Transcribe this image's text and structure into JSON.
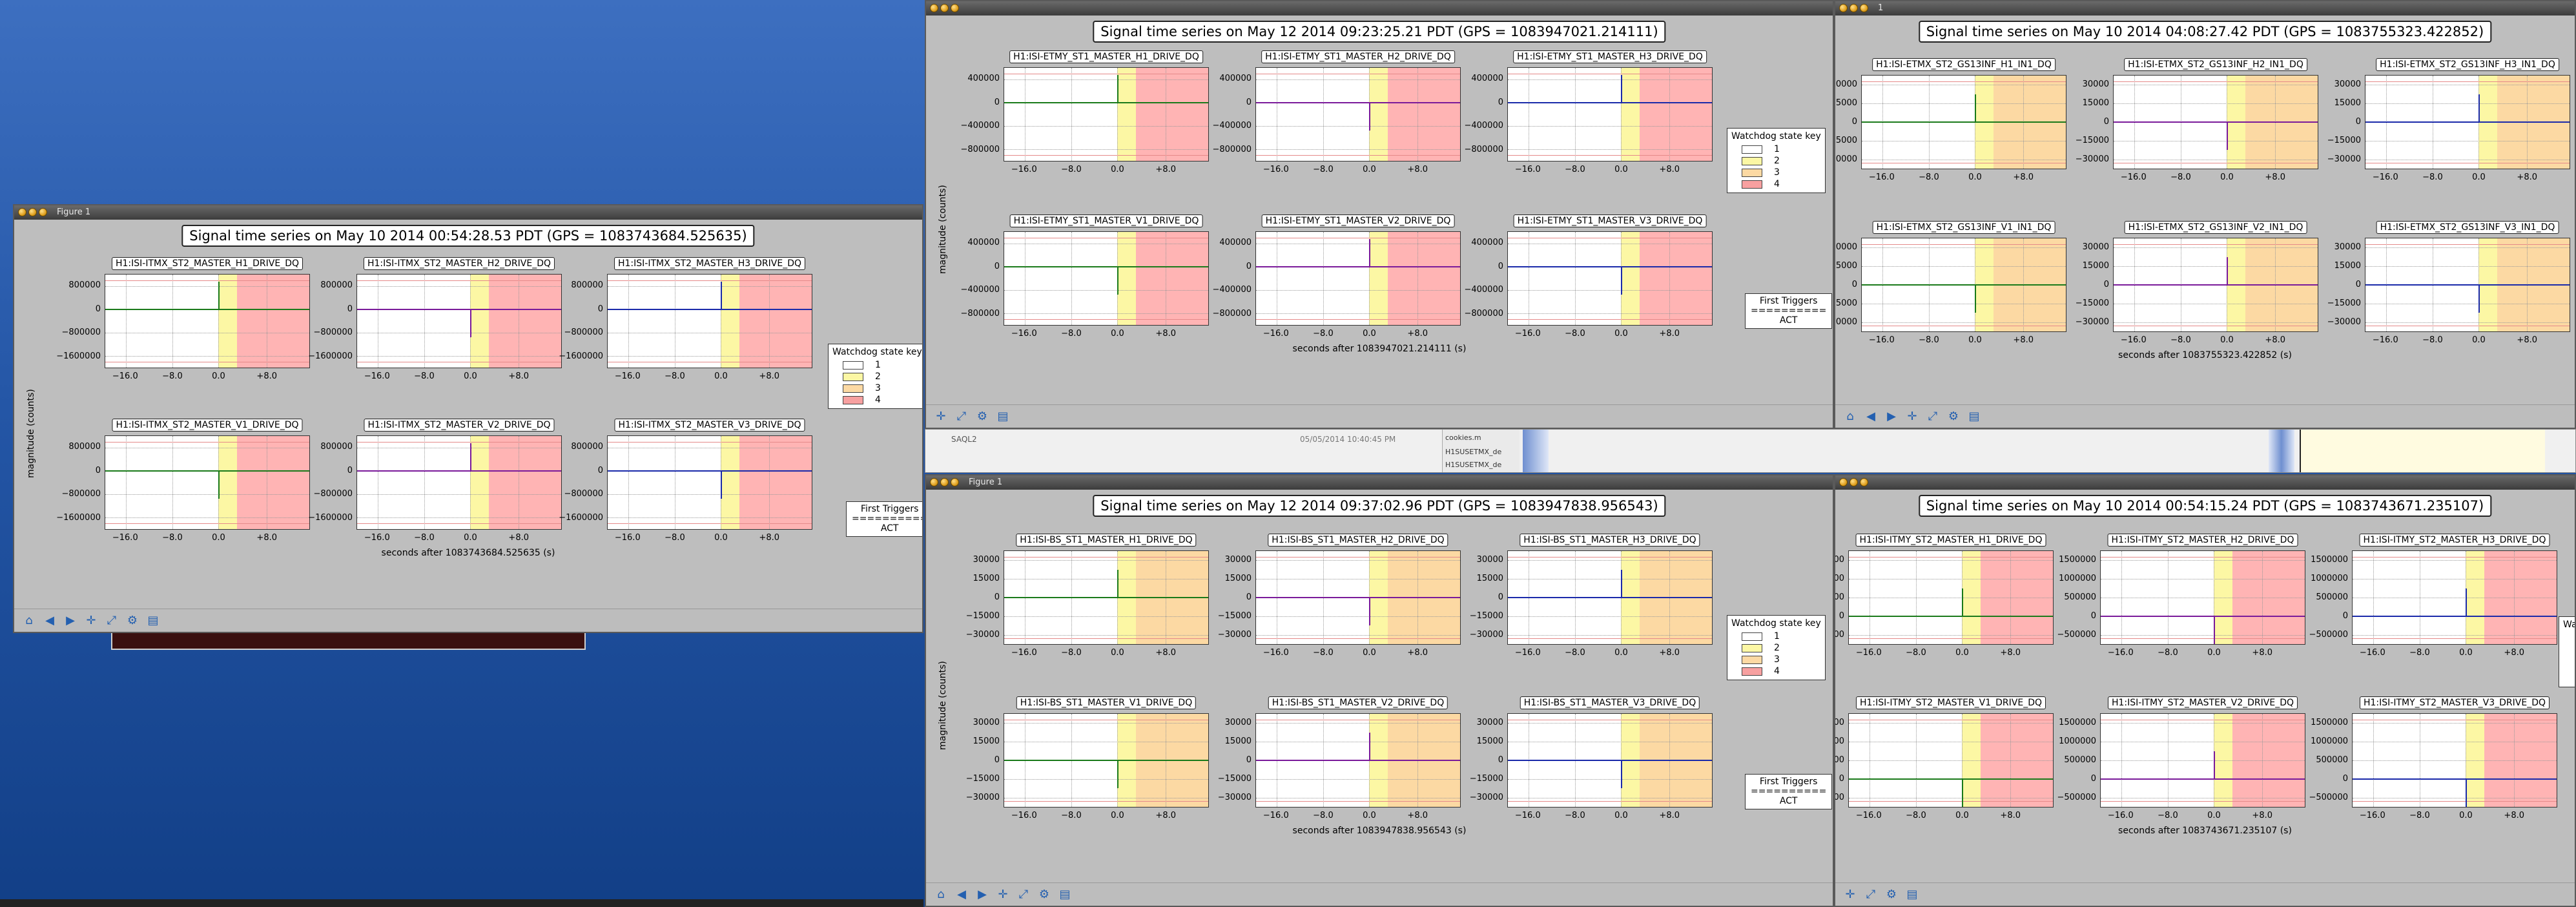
{
  "desktop": {
    "bg_top": "#3d6fc0",
    "bg_bottom": "#123f87"
  },
  "figures": [
    {
      "id": "fig-itmx",
      "window_title": "Figure 1",
      "title": "Signal time series on May 10 2014 00:54:28.53 PDT (GPS = 1083743684.525635)",
      "xlabel": "seconds after 1083743684.525635 (s)",
      "ylabel": "magnitude (counts)",
      "yticks": [
        "800000",
        "0",
        "−800000",
        "−1600000"
      ],
      "xticks": [
        "−16.0",
        "−8.0",
        "0.0",
        "+8.0"
      ],
      "panels": [
        {
          "title": "H1:ISI-ITMX_ST2_MASTER_H1_DRIVE_DQ",
          "color": "#1a7a1a"
        },
        {
          "title": "H1:ISI-ITMX_ST2_MASTER_H2_DRIVE_DQ",
          "color": "#7a1a9a"
        },
        {
          "title": "H1:ISI-ITMX_ST2_MASTER_H3_DRIVE_DQ",
          "color": "#1a2aaa"
        },
        {
          "title": "H1:ISI-ITMX_ST2_MASTER_V1_DRIVE_DQ",
          "color": "#1a7a1a"
        },
        {
          "title": "H1:ISI-ITMX_ST2_MASTER_V2_DRIVE_DQ",
          "color": "#7a1a9a"
        },
        {
          "title": "H1:ISI-ITMX_ST2_MASTER_V3_DRIVE_DQ",
          "color": "#1a2aaa"
        }
      ],
      "legend": {
        "title": "Watchdog state key",
        "items": [
          "1",
          "2",
          "3",
          "4"
        ]
      },
      "triggers": {
        "title": "First Triggers",
        "sep": "==========",
        "value": "ACT"
      }
    },
    {
      "id": "fig-etmy",
      "window_title": "",
      "title": "Signal time series on May 12 2014 09:23:25.21 PDT (GPS = 1083947021.214111)",
      "xlabel": "seconds after 1083947021.214111 (s)",
      "ylabel": "magnitude (counts)",
      "yticks": [
        "400000",
        "0",
        "−400000",
        "−800000"
      ],
      "xticks": [
        "−16.0",
        "−8.0",
        "0.0",
        "+8.0"
      ],
      "panels": [
        {
          "title": "H1:ISI-ETMY_ST1_MASTER_H1_DRIVE_DQ",
          "color": "#1a7a1a"
        },
        {
          "title": "H1:ISI-ETMY_ST1_MASTER_H2_DRIVE_DQ",
          "color": "#7a1a9a"
        },
        {
          "title": "H1:ISI-ETMY_ST1_MASTER_H3_DRIVE_DQ",
          "color": "#1a2aaa"
        },
        {
          "title": "H1:ISI-ETMY_ST1_MASTER_V1_DRIVE_DQ",
          "color": "#1a7a1a"
        },
        {
          "title": "H1:ISI-ETMY_ST1_MASTER_V2_DRIVE_DQ",
          "color": "#7a1a9a"
        },
        {
          "title": "H1:ISI-ETMY_ST1_MASTER_V3_DRIVE_DQ",
          "color": "#1a2aaa"
        }
      ],
      "legend": {
        "title": "Watchdog state key",
        "items": [
          "1",
          "2",
          "3",
          "4"
        ]
      },
      "triggers": {
        "title": "First Triggers",
        "sep": "==========",
        "value": "ACT"
      }
    },
    {
      "id": "fig-etmx",
      "window_title": "1",
      "title": "Signal time series on May 10 2014 04:08:27.42 PDT (GPS = 1083755323.422852)",
      "xlabel": "seconds after 1083755323.422852 (s)",
      "ylabel": "",
      "yticks": [
        "30000",
        "15000",
        "0",
        "−15000",
        "−30000"
      ],
      "xticks": [
        "−16.0",
        "−8.0",
        "0.0",
        "+8.0"
      ],
      "panels": [
        {
          "title": "H1:ISI-ETMX_ST2_GS13INF_H1_IN1_DQ",
          "color": "#1a7a1a"
        },
        {
          "title": "H1:ISI-ETMX_ST2_GS13INF_H2_IN1_DQ",
          "color": "#7a1a9a"
        },
        {
          "title": "H1:ISI-ETMX_ST2_GS13INF_H3_IN1_DQ",
          "color": "#1a2aaa"
        },
        {
          "title": "H1:ISI-ETMX_ST2_GS13INF_V1_IN1_DQ",
          "color": "#1a7a1a"
        },
        {
          "title": "H1:ISI-ETMX_ST2_GS13INF_V2_IN1_DQ",
          "color": "#7a1a9a"
        },
        {
          "title": "H1:ISI-ETMX_ST2_GS13INF_V3_IN1_DQ",
          "color": "#1a2aaa"
        }
      ]
    },
    {
      "id": "fig-bs",
      "window_title": "Figure 1",
      "title": "Signal time series on May 12 2014 09:37:02.96 PDT (GPS = 1083947838.956543)",
      "xlabel": "seconds after 1083947838.956543 (s)",
      "ylabel": "magnitude (counts)",
      "yticks": [
        "30000",
        "15000",
        "0",
        "−15000",
        "−30000"
      ],
      "xticks": [
        "−16.0",
        "−8.0",
        "0.0",
        "+8.0"
      ],
      "panels": [
        {
          "title": "H1:ISI-BS_ST1_MASTER_H1_DRIVE_DQ",
          "color": "#1a7a1a"
        },
        {
          "title": "H1:ISI-BS_ST1_MASTER_H2_DRIVE_DQ",
          "color": "#7a1a9a"
        },
        {
          "title": "H1:ISI-BS_ST1_MASTER_H3_DRIVE_DQ",
          "color": "#1a2aaa"
        },
        {
          "title": "H1:ISI-BS_ST1_MASTER_V1_DRIVE_DQ",
          "color": "#1a7a1a"
        },
        {
          "title": "H1:ISI-BS_ST1_MASTER_V2_DRIVE_DQ",
          "color": "#7a1a9a"
        },
        {
          "title": "H1:ISI-BS_ST1_MASTER_V3_DRIVE_DQ",
          "color": "#1a2aaa"
        }
      ],
      "legend": {
        "title": "Watchdog state key",
        "items": [
          "1",
          "2",
          "3",
          "4"
        ]
      },
      "triggers": {
        "title": "First Triggers",
        "sep": "==========",
        "value": "ACT"
      }
    },
    {
      "id": "fig-itmy",
      "window_title": "",
      "title": "Signal time series on May 10 2014 00:54:15.24 PDT (GPS = 1083743671.235107)",
      "xlabel": "seconds after 1083743671.235107 (s)",
      "ylabel": "",
      "yticks": [
        "1500000",
        "1000000",
        "500000",
        "0",
        "−500000"
      ],
      "xticks": [
        "−16.0",
        "−8.0",
        "0.0",
        "+8.0"
      ],
      "panels": [
        {
          "title": "H1:ISI-ITMY_ST2_MASTER_H1_DRIVE_DQ",
          "color": "#1a7a1a"
        },
        {
          "title": "H1:ISI-ITMY_ST2_MASTER_H2_DRIVE_DQ",
          "color": "#7a1a9a"
        },
        {
          "title": "H1:ISI-ITMY_ST2_MASTER_H3_DRIVE_DQ",
          "color": "#1a2aaa"
        },
        {
          "title": "H1:ISI-ITMY_ST2_MASTER_V1_DRIVE_DQ",
          "color": "#1a7a1a"
        },
        {
          "title": "H1:ISI-ITMY_ST2_MASTER_V2_DRIVE_DQ",
          "color": "#7a1a9a"
        },
        {
          "title": "H1:ISI-ITMY_ST2_MASTER_V3_DRIVE_DQ",
          "color": "#1a2aaa"
        }
      ],
      "legend_partial": "Wa"
    }
  ],
  "task_strip": {
    "item1": "SAQL2",
    "date": "05/05/2014 10:40:45 PM",
    "files": [
      "cookies.m",
      "H1SUSETMX_de",
      "H1SUSETMX_de"
    ]
  },
  "legend_colors": {
    "s1": "#ffffff",
    "s2": "#fcf7a4",
    "s3": "#fcd9a3",
    "s4": "#f7a0a0"
  }
}
